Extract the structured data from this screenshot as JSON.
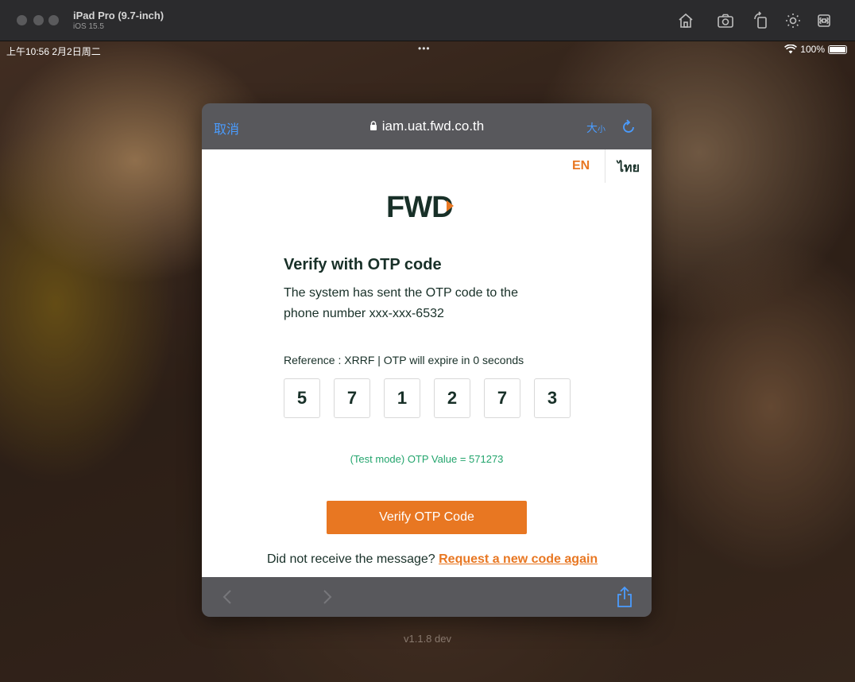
{
  "simulator": {
    "device_name": "iPad Pro (9.7-inch)",
    "os_version": "iOS 15.5"
  },
  "statusbar": {
    "time_date": "上午10:56  2月2日周二",
    "battery": "100%"
  },
  "safari": {
    "cancel_label": "取消",
    "url": "iam.uat.fwd.co.th",
    "text_size_label": "大",
    "text_size_small": "小"
  },
  "page": {
    "lang_en": "EN",
    "lang_th": "ไทย",
    "logo_text": "FWD",
    "title": "Verify with OTP code",
    "description": "The system has sent the OTP code to the phone number xxx-xxx-6532",
    "reference": "Reference : XRRF | OTP will expire in 0 seconds",
    "otp_digits": [
      "5",
      "7",
      "1",
      "2",
      "7",
      "3"
    ],
    "test_mode": "(Test mode) OTP Value = 571273",
    "verify_button": "Verify OTP Code",
    "resend_prefix": "Did not receive the message? ",
    "resend_link": "Request a new code again"
  },
  "version": "v1.1.8 dev",
  "colors": {
    "brand_orange": "#e87722",
    "brand_green": "#183028",
    "test_green": "#23a56d",
    "ios_blue": "#4a9cff"
  }
}
